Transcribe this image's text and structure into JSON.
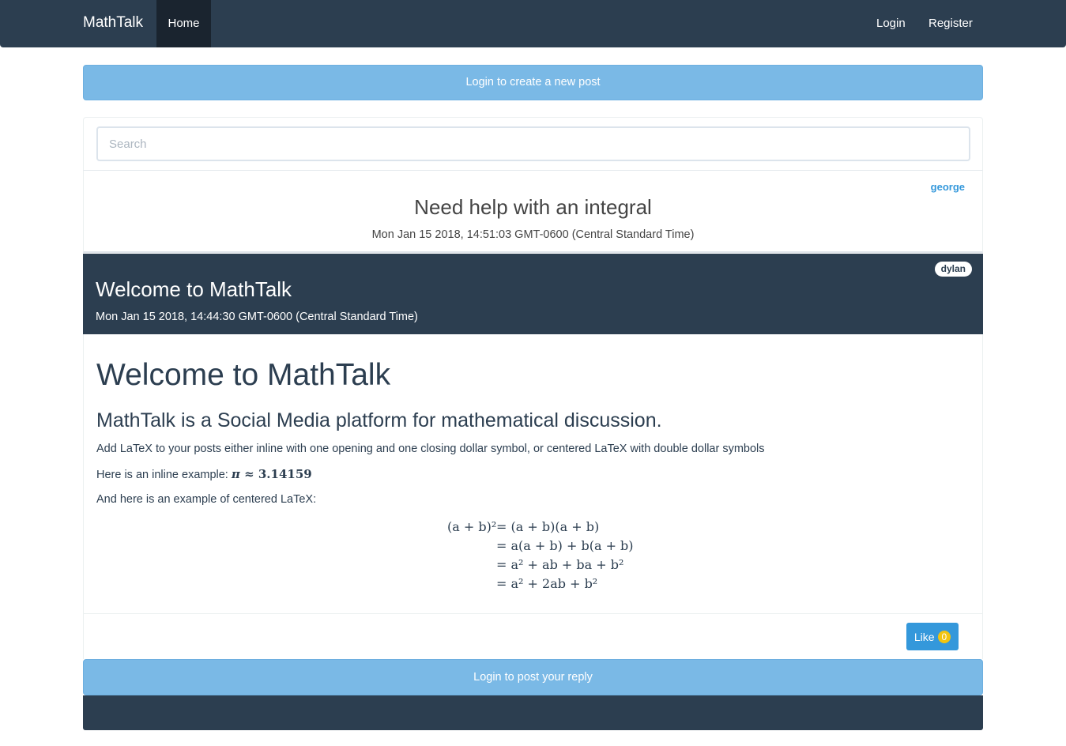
{
  "navbar": {
    "brand": "MathTalk",
    "home": "Home",
    "login": "Login",
    "register": "Register"
  },
  "login_banner": "Login to create a new post",
  "search": {
    "placeholder": "Search",
    "value": ""
  },
  "posts": [
    {
      "author": "george",
      "title": "Need help with an integral",
      "date": "Mon Jan 15 2018, 14:51:03 GMT-0600 (Central Standard Time)"
    },
    {
      "author": "dylan",
      "title": "Welcome to MathTalk",
      "date": "Mon Jan 15 2018, 14:44:30 GMT-0600 (Central Standard Time)",
      "body": {
        "heading": "Welcome to MathTalk",
        "subheading": "MathTalk is a Social Media platform for mathematical discussion.",
        "paragraph1": "Add LaTeX to your posts either inline with one opening and one closing dollar symbol, or centered LaTeX with double dollar symbols",
        "paragraph2_prefix": "Here is an inline example: ",
        "inline_math_pi": "π",
        "inline_math_rest": " ≈ 3.14159",
        "paragraph3": "And here is an example of centered LaTeX:",
        "equation": {
          "lhs": "(a + b)²",
          "lines": [
            "= (a + b)(a + b)",
            "= a(a + b) + b(a + b)",
            "= a² + ab + ba + b²",
            "= a² + 2ab + b²"
          ]
        }
      },
      "like_label": "Like",
      "like_count": "0",
      "reply_banner": "Login to post your reply"
    }
  ],
  "colors": {
    "navbar": "#2c3e50",
    "banner": "#7ab9e6",
    "link": "#3498db",
    "like_button": "#3498db",
    "like_badge": "#f1c40f"
  }
}
